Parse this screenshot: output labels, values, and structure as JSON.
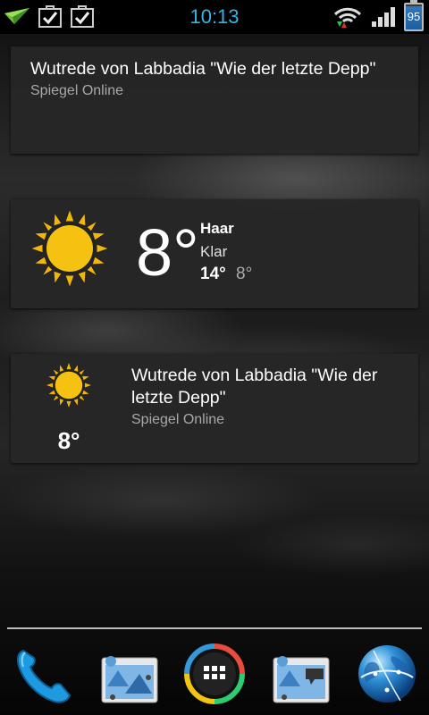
{
  "status_bar": {
    "clock": "10:13",
    "battery": "95",
    "icons": [
      "paper-plane-icon",
      "checkbox-icon",
      "checkbox-icon",
      "wifi-icon",
      "signal-icon",
      "battery-icon"
    ]
  },
  "news_widget": {
    "title": "Wutrede von Labbadia \"Wie der letzte Depp\"",
    "source": "Spiegel Online"
  },
  "weather_widget": {
    "temperature": "8°",
    "location": "Haar",
    "condition": "Klar",
    "high": "14°",
    "low": "8°",
    "icon": "sun-icon"
  },
  "combo_widget": {
    "temperature": "8°",
    "title": "Wutrede von Labbadia \"Wie der letzte Depp\"",
    "source": "Spiegel Online",
    "icon": "sun-icon"
  },
  "dock": {
    "items": [
      "phone-icon",
      "folder-icon",
      "app-drawer-icon",
      "folder-icon",
      "browser-globe-icon"
    ]
  }
}
